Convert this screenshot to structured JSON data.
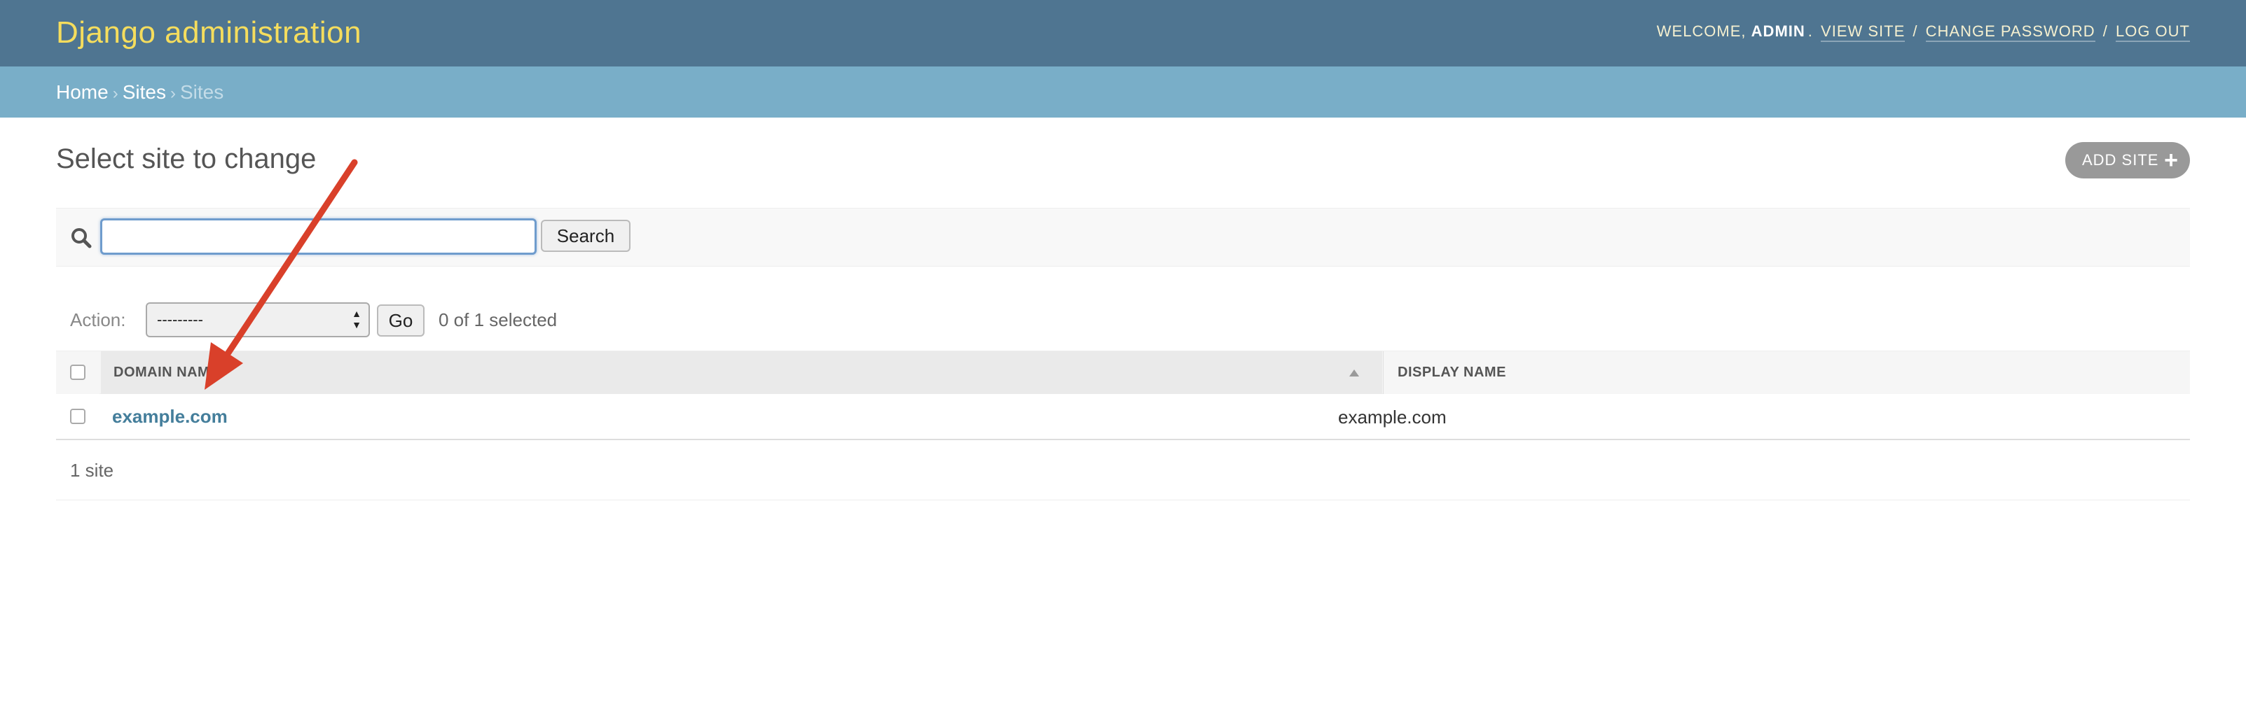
{
  "header": {
    "branding": "Django administration",
    "welcome": "WELCOME,",
    "username": "ADMIN",
    "view_site": "VIEW SITE",
    "change_password": "CHANGE PASSWORD",
    "log_out": "LOG OUT"
  },
  "breadcrumbs": {
    "home": "Home",
    "app": "Sites",
    "current": "Sites"
  },
  "main": {
    "title": "Select site to change",
    "add_button": "ADD SITE"
  },
  "search": {
    "value": "",
    "button": "Search"
  },
  "actions": {
    "label": "Action:",
    "selected_option": "---------",
    "go": "Go",
    "selected_count": "0 of 1 selected"
  },
  "table": {
    "columns": [
      "DOMAIN NAME",
      "DISPLAY NAME"
    ],
    "rows": [
      {
        "domain": "example.com",
        "display": "example.com"
      }
    ],
    "footer": "1 site"
  },
  "colors": {
    "header_bg": "#4f7591",
    "breadcrumb_bg": "#79aec8",
    "branding": "#f5dd5d",
    "link": "#447e9b",
    "annotation_arrow": "#d9402a"
  }
}
